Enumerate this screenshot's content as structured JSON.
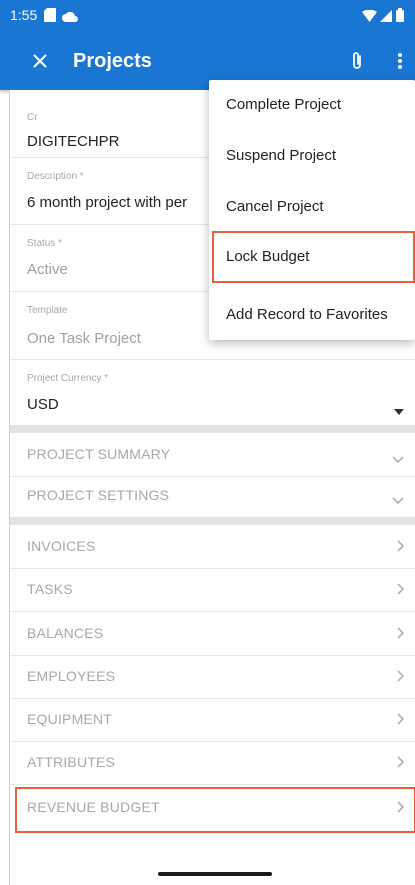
{
  "status_bar": {
    "time": "1:55"
  },
  "app_bar": {
    "title": "Projects",
    "close_icon": "close-icon",
    "attach_icon": "paperclip-icon",
    "more_icon": "more-vert-icon"
  },
  "form": {
    "cr": {
      "label": "Cr",
      "value": "DIGITECHPR"
    },
    "description": {
      "label": "Description *",
      "value": "6 month project with per"
    },
    "status": {
      "label": "Status *",
      "value": "Active"
    },
    "template": {
      "label": "Template",
      "value": "One Task Project"
    },
    "currency": {
      "label": "Project Currency *",
      "value": "USD"
    }
  },
  "groups": [
    {
      "label": "PROJECT SUMMARY"
    },
    {
      "label": "PROJECT SETTINGS"
    }
  ],
  "sections": [
    {
      "label": "INVOICES"
    },
    {
      "label": "TASKS"
    },
    {
      "label": "BALANCES"
    },
    {
      "label": "EMPLOYEES"
    },
    {
      "label": "EQUIPMENT"
    },
    {
      "label": "ATTRIBUTES"
    },
    {
      "label": "REVENUE BUDGET"
    }
  ],
  "menu": {
    "items": [
      {
        "label": "Complete Project"
      },
      {
        "label": "Suspend Project"
      },
      {
        "label": "Cancel Project"
      },
      {
        "label": "Lock Budget"
      },
      {
        "label": "Add Record to Favorites"
      }
    ]
  },
  "colors": {
    "primary": "#1976d2",
    "highlight": "#e8603a"
  }
}
